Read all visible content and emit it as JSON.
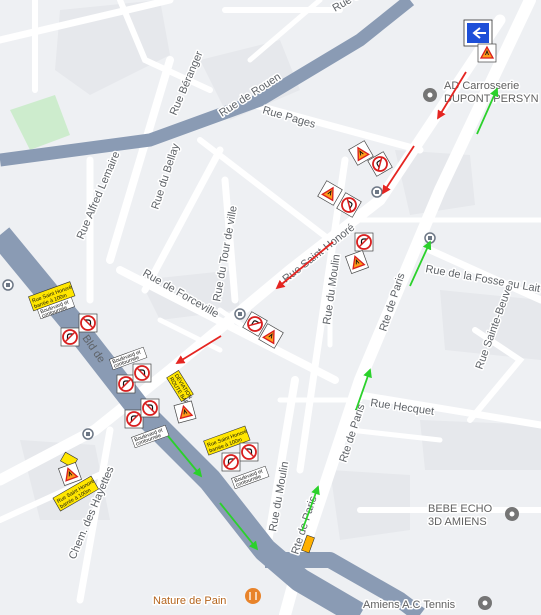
{
  "streets": {
    "rue_de_rouen": "Rue de Rouen",
    "rue_beranger": "Rue Béranger",
    "rue_alfred_lemaire": "Rue Alfred Lemaire",
    "rue_du_bellay": "Rue du Bellay",
    "rue_pages": "Rue Pages",
    "rue_saint_honore": "Rue Saint-Honoré",
    "rue_du_tour_de_ville": "Rue du Tour de ville",
    "rue_de_forceville": "Rue de Forceville",
    "rue_du_moulin_upper": "Rue du Moulin",
    "rue_du_moulin_lower": "Rue du Moulin",
    "rte_de_paris_upper": "Rte de Paris",
    "rte_de_paris_mid": "Rte de Paris",
    "rte_de_paris_lower": "Rte de Paris",
    "rue_de_la_fosse": "Rue de la Fosse au Lait",
    "rue_sainte_beuve": "Rue Sainte-Beuve",
    "rue_hecquet": "Rue Hecquet",
    "chem_des_hayettes": "Chem. des Hayettes",
    "rue_de_la_top": "Rue de la",
    "bld_label": "Bld de"
  },
  "pois": {
    "carrosserie_line1": "AD Carrosserie",
    "carrosserie_line2": "DUPONT PERSYN",
    "bebe_echo_line1": "BEBE ECHO",
    "bebe_echo_line2": "3D AMIENS",
    "nature_de_pain": "Nature de Pain",
    "amiens_tennis": "Amiens A.C Tennis"
  },
  "signs": {
    "rue_barree_a_line1": "Rue Saint Honoré",
    "rue_barree_a_line2": "barrée à 100m",
    "sauf_riverains_a_line1": "Boulevard et",
    "sauf_riverains_a_line2": "contournée",
    "rue_barree_b_line1": "Rue Saint Honoré",
    "rue_barree_b_line2": "barrée à 100m",
    "sauf_riverains_b_line1": "Boulevard et",
    "sauf_riverains_b_line2": "contournée",
    "sauf_riverains_c_line1": "Boulevard et",
    "sauf_riverains_c_line2": "contournée",
    "sauf_riverains_d_line1": "Boulevard et",
    "sauf_riverains_d_line2": "contournée",
    "rue_barree_c_line1": "Rue Saint Honoré",
    "rue_barree_c_line2": "barrée à 100m",
    "deviation_tag": "DÉVIATION",
    "route_barree_tag": "ROUTE BARRÉE"
  },
  "colors": {
    "background": "#eef0f3",
    "block": "#e4e6ea",
    "minor_road": "#ffffff",
    "major_road": "#8a9bb4",
    "park": "#cdeccd",
    "arrow_red": "#e52521",
    "arrow_green": "#2bd12b",
    "sign_yellow": "#ffe600",
    "sign_red": "#d81e1e",
    "sign_orange": "#ff8c1a",
    "sign_blue": "#1d4fd8",
    "poi_grey": "#757575",
    "poi_food": "#e8832a"
  },
  "icons": {
    "bus_stop": "bus-stop-icon",
    "poi_pin": "location-pin-icon",
    "restaurant": "fork-knife-icon",
    "roadworks": "roadworks-triangle-icon",
    "no_turn_left": "no-left-turn-icon",
    "no_turn_right": "no-right-turn-icon",
    "no_u_turn": "no-u-turn-icon",
    "one_way": "one-way-arrow-icon"
  }
}
